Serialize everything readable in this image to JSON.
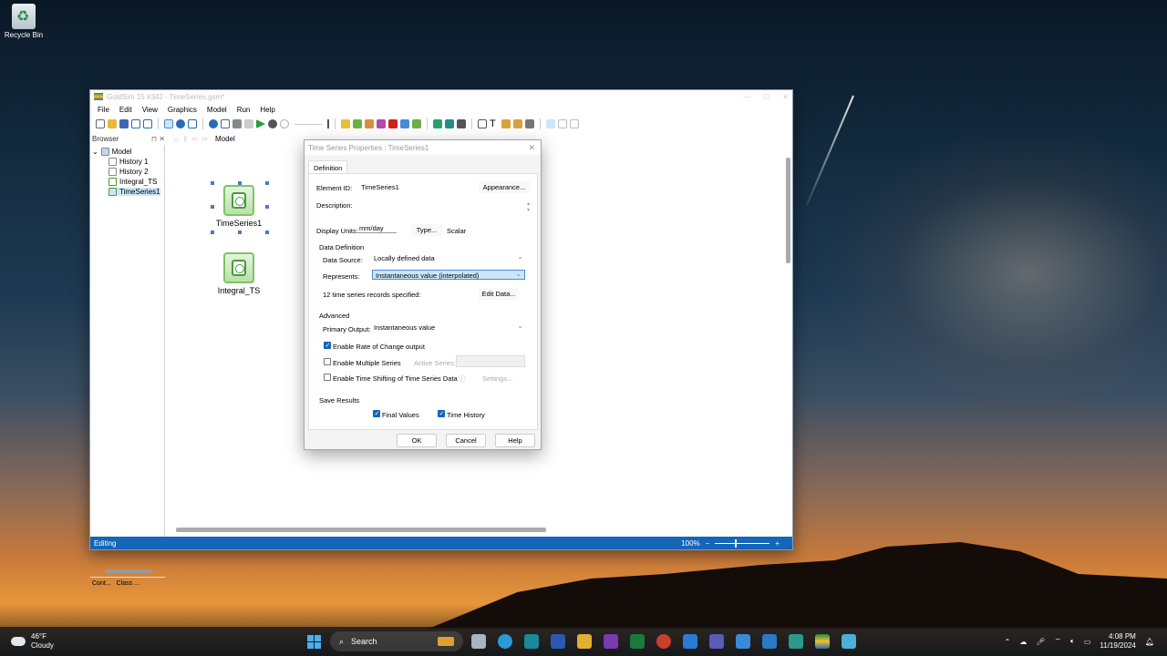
{
  "desktop": {
    "recycle_bin": "Recycle Bin"
  },
  "app": {
    "title": "GoldSim 15 #342 - TimeSeries.gsm*",
    "menu": [
      "File",
      "Edit",
      "View",
      "Graphics",
      "Model",
      "Run",
      "Help"
    ],
    "browser_label": "Browser",
    "browser_pin": "⊓ ✕",
    "breadcrumb": "Model",
    "tree": {
      "root": "Model",
      "items": [
        "History 1",
        "History 2",
        "Integral_TS",
        "TimeSeries1"
      ]
    },
    "browser_tabs": [
      "Cont...",
      "Class ..."
    ],
    "canvas_elements": [
      "TimeSeries1",
      "Integral_TS"
    ],
    "status": "Editing",
    "zoom": "100%",
    "zoom_minus": "−",
    "zoom_plus": "+"
  },
  "dialog": {
    "title": "Time Series Properties : TimeSeries1",
    "tab": "Definition",
    "element_id_label": "Element ID:",
    "element_id_value": "TimeSeries1",
    "appearance_button": "Appearance...",
    "description_label": "Description:",
    "display_units_label": "Display Units:",
    "display_units_value": "mm/day",
    "type_button": "Type...",
    "type_value": "Scalar",
    "data_definition_header": "Data Definition",
    "data_source_label": "Data Source:",
    "data_source_value": "Locally defined data",
    "represents_label": "Represents:",
    "represents_value": "Instantaneous value (interpolated)",
    "records_text": "12 time series records specified:",
    "edit_data_button": "Edit Data...",
    "advanced_header": "Advanced",
    "primary_output_label": "Primary Output:",
    "primary_output_value": "Instantaneous value",
    "rate_of_change_label": "Enable Rate of Change output",
    "rate_of_change_checked": true,
    "multiple_series_label": "Enable Multiple Series",
    "multiple_series_checked": false,
    "active_series_label": "Active Series:",
    "time_shifting_label": "Enable Time Shifting of Time Series Data",
    "time_shifting_checked": false,
    "settings_button": "Settings...",
    "save_results_header": "Save Results",
    "final_values_label": "Final Values",
    "final_values_checked": true,
    "time_history_label": "Time History",
    "time_history_checked": true,
    "ok_button": "OK",
    "cancel_button": "Cancel",
    "help_button": "Help"
  },
  "taskbar": {
    "weather_temp": "46°F",
    "weather_desc": "Cloudy",
    "search_placeholder": "Search",
    "time": "4:08 PM",
    "date": "11/19/2024"
  }
}
